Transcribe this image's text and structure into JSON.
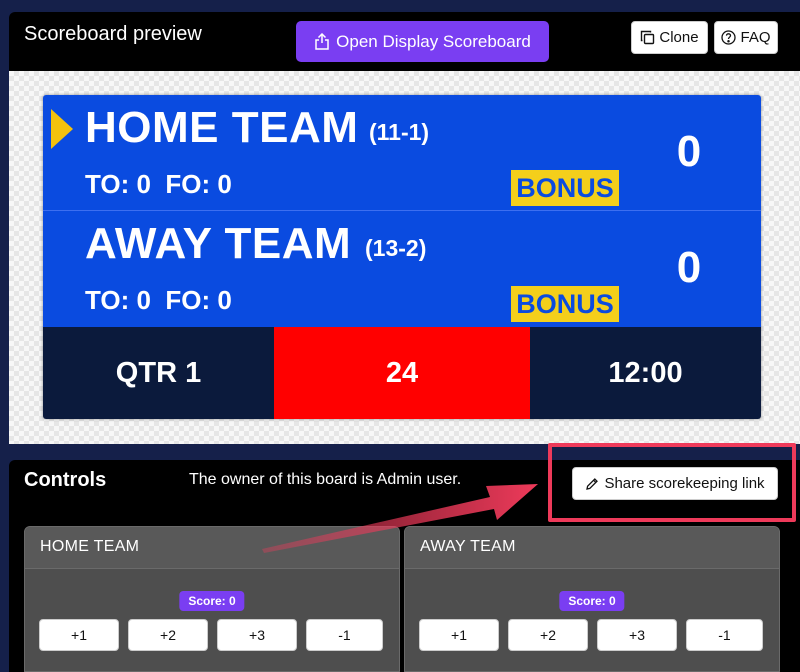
{
  "preview": {
    "title": "Scoreboard preview",
    "open_display_label": "Open Display Scoreboard",
    "clone_label": "Clone",
    "faq_label": "FAQ"
  },
  "scoreboard": {
    "home": {
      "name": "HOME TEAM",
      "record": "(11-1)",
      "stats": "TO: 0  FO: 0",
      "bonus": "BONUS",
      "score": "0",
      "has_possession": true
    },
    "away": {
      "name": "AWAY TEAM",
      "record": "(13-2)",
      "stats": "TO: 0  FO: 0",
      "bonus": "BONUS",
      "score": "0",
      "has_possession": false
    },
    "period": "QTR 1",
    "shot_clock": "24",
    "game_clock": "12:00"
  },
  "controls": {
    "title": "Controls",
    "owner_text": "The owner of this board is Admin user.",
    "share_label": "Share scorekeeping link",
    "home_card": {
      "title": "HOME TEAM",
      "score_badge": "Score: 0",
      "buttons": [
        "+1",
        "+2",
        "+3",
        "-1"
      ]
    },
    "away_card": {
      "title": "AWAY TEAM",
      "score_badge": "Score: 0",
      "buttons": [
        "+1",
        "+2",
        "+3",
        "-1"
      ]
    }
  },
  "colors": {
    "accent": "#7a3ef2",
    "team_blue": "#0a4be0",
    "bonus_yellow": "#f4cf1b",
    "shot_clock_red": "#ff0000",
    "annotation_red": "#ee3a5a"
  },
  "icons": {
    "open_display": "share-upload-icon",
    "clone": "copy-icon",
    "faq": "question-circle-icon",
    "share": "pencil-icon",
    "possession": "possession-arrow-icon"
  }
}
